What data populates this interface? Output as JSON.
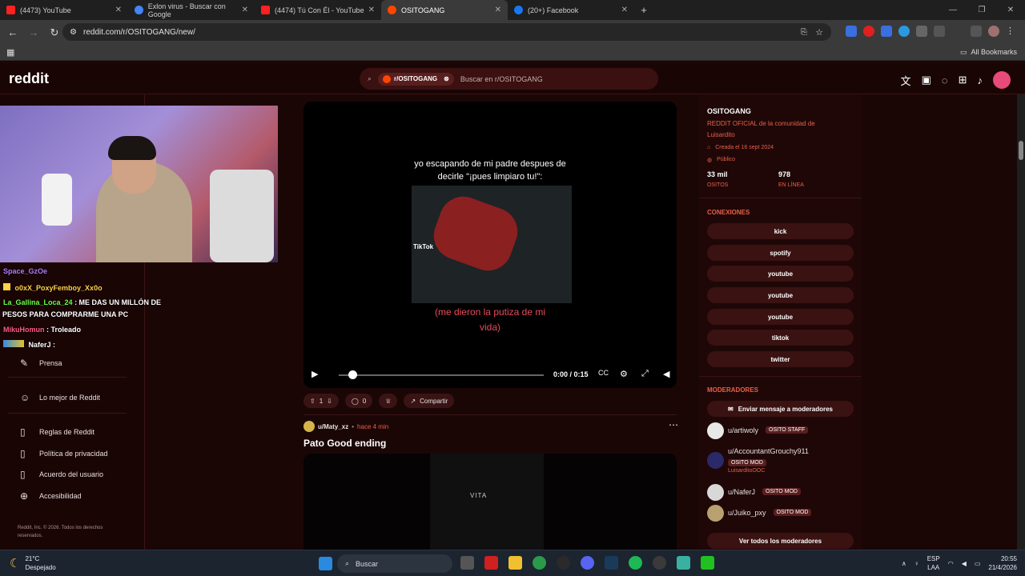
{
  "browser": {
    "tabs": [
      {
        "title": "(4473) YouTube",
        "color": "#ff2020"
      },
      {
        "title": "Exlon virus - Buscar con Google",
        "color": "#4285f4"
      },
      {
        "title": "(4474) Tú Con Él - YouTube",
        "color": "#ff2020"
      },
      {
        "title": "OSITOGANG",
        "color": "#ff4500"
      },
      {
        "title": "(20+) Facebook",
        "color": "#1877f2"
      }
    ],
    "url": "reddit.com/r/OSITOGANG/new/",
    "bookmarks_label": "All Bookmarks"
  },
  "reddit": {
    "logo": "reddit",
    "search_chip": "r/OSITOGANG",
    "search_placeholder": "Buscar en r/OSITOGANG"
  },
  "sidebar": {
    "items": [
      {
        "label": "Prensa",
        "icon": "pen-icon"
      },
      {
        "label": "Lo mejor de Reddit",
        "icon": "reddit-icon"
      },
      {
        "label": "Reglas de Reddit",
        "icon": "book-icon"
      },
      {
        "label": "Política de privacidad",
        "icon": "book-icon"
      },
      {
        "label": "Acuerdo del usuario",
        "icon": "book-icon"
      },
      {
        "label": "Accesibilidad",
        "icon": "accessibility-icon"
      }
    ],
    "footer": "Reddit, Inc. © 2026. Todos los derechos reservados."
  },
  "chat": [
    {
      "user": "Space_GzOe",
      "msg": "",
      "color": "#b07aff"
    },
    {
      "user": "o0xX_PoxyFemboy_Xx0o",
      "msg": "",
      "color": "#ffd24a"
    },
    {
      "user": "La_Gallina_Loca_24",
      "msg": ": ME DAS UN MILLÓN DE",
      "color": "#6aff4a"
    },
    {
      "user": "",
      "msg": "PESOS PARA COMPRARME UNA PC",
      "color": "#ffffff"
    },
    {
      "user": "MikuHomun",
      "msg": ": Troleado",
      "color": "#ff5a8a"
    },
    {
      "user": "NaferJ",
      "msg": ":",
      "color": "#ffffff"
    }
  ],
  "post1": {
    "caption": "yo escapando de mi padre despues de decirle \"¡pues limpiaro tu!\":",
    "caption_red": "(me dieron la putiza de mi vida)",
    "tiktok_label": "TikTok",
    "time": "0:00 / 0:15",
    "progress": 0,
    "votes": "1",
    "comments": "0",
    "share": "Compartir"
  },
  "post2": {
    "user": "u/Maty_xz",
    "time": "hace 4 min",
    "title": "Pato Good ending",
    "watermark": "VITA"
  },
  "community": {
    "name": "OSITOGANG",
    "description": "REDDIT OFICIAL de la comunidad de Luisardito",
    "created": "Creada el 16 sept 2024",
    "visibility": "Público",
    "members": "33 mil",
    "members_label": "OSITOS",
    "online": "978",
    "online_label": "EN LÍNEA",
    "connections_title": "CONEXIONES",
    "connections": [
      "kick",
      "spotify",
      "youtube",
      "youtube",
      "youtube",
      "tiktok",
      "twitter"
    ],
    "moderators_title": "MODERADORES",
    "message_mods": "Enviar mensaje a moderadores",
    "moderators": [
      {
        "name": "u/artiwoly",
        "flair": "OSITO STAFF",
        "sub": ""
      },
      {
        "name": "u/AccountantGrouchy911",
        "flair": "OSITO MOD",
        "sub": "LuisarditoOOC"
      },
      {
        "name": "u/NaferJ",
        "flair": "OSITO MOD",
        "sub": ""
      },
      {
        "name": "u/Juiko_pxy",
        "flair": "OSITO MOD",
        "sub": ""
      }
    ],
    "view_all_mods": "Ver todos los moderadores"
  },
  "taskbar": {
    "temp": "21°C",
    "weather": "Despejado",
    "search": "Buscar",
    "lang1": "ESP",
    "lang2": "LAA",
    "clock_time": "20:55",
    "clock_date": "21/4/2026"
  }
}
